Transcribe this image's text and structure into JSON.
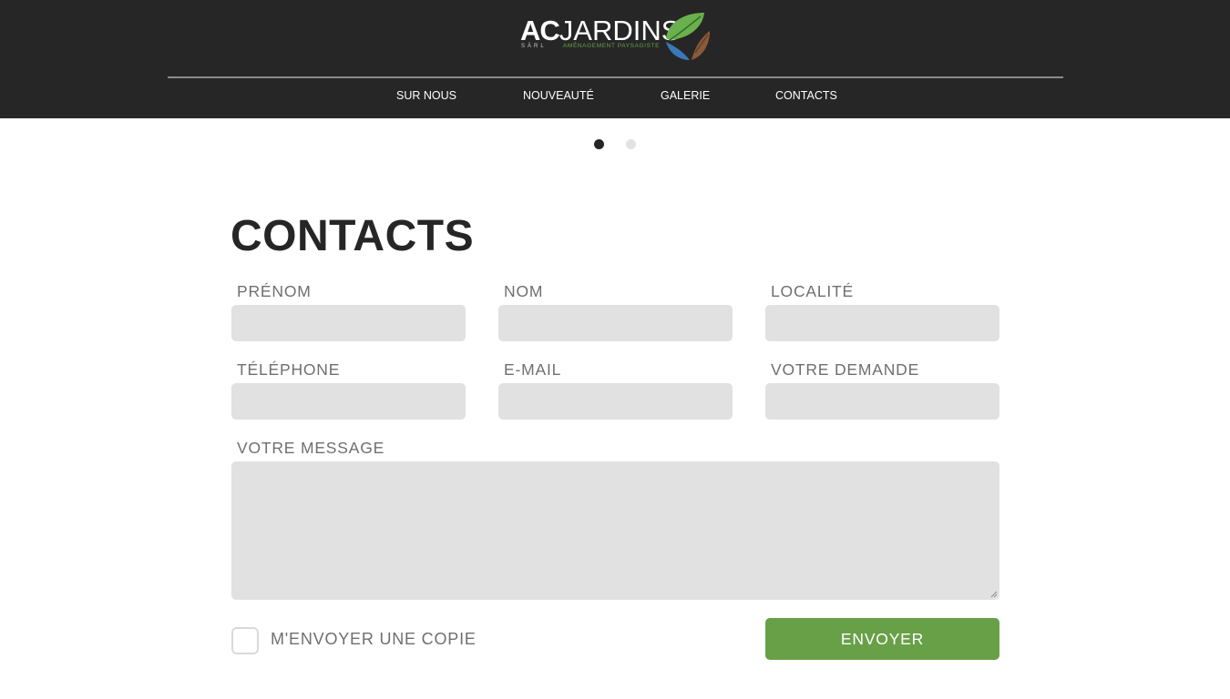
{
  "brand": {
    "logo_main_ac": "AC",
    "logo_main_jardins": "JARDINS",
    "logo_sarl": "SÀRL",
    "logo_tagline": "AMÉNAGEMENT PAYSAGISTE",
    "leaf_icon": "leaf-logo-icon",
    "colors": {
      "header_bg": "#262626",
      "accent_green": "#68a047",
      "field_bg": "#e1e1e1"
    }
  },
  "nav": {
    "items": [
      {
        "label": "SUR NOUS"
      },
      {
        "label": "NOUVEAUTÉ"
      },
      {
        "label": "GALERIE"
      },
      {
        "label": "CONTACTS"
      }
    ]
  },
  "slider": {
    "slides": 2,
    "active_index": 0
  },
  "contact": {
    "title": "CONTACTS",
    "fields": {
      "prenom": {
        "label": "PRÉNOM",
        "value": ""
      },
      "nom": {
        "label": "NOM",
        "value": ""
      },
      "localite": {
        "label": "LOCALITÉ",
        "value": ""
      },
      "telephone": {
        "label": "TÉLÉPHONE",
        "value": ""
      },
      "email": {
        "label": "E-MAIL",
        "value": ""
      },
      "demande": {
        "label": "VOTRE DEMANDE",
        "value": ""
      },
      "message": {
        "label": "VOTRE MESSAGE",
        "value": ""
      }
    },
    "copy_checkbox": {
      "label": "M'ENVOYER UNE COPIE",
      "checked": false
    },
    "submit_label": "ENVOYER"
  }
}
